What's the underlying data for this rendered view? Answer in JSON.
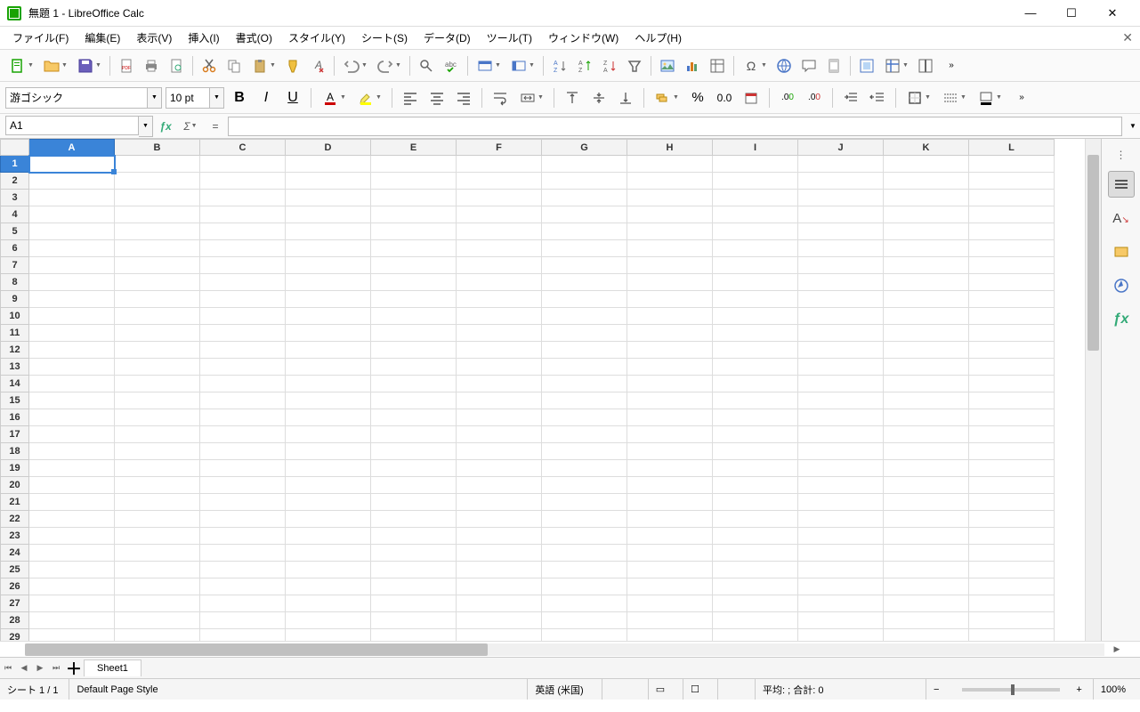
{
  "window": {
    "title": "無題 1 - LibreOffice Calc"
  },
  "menu": {
    "file": "ファイル(F)",
    "edit": "編集(E)",
    "view": "表示(V)",
    "insert": "挿入(I)",
    "format": "書式(O)",
    "style": "スタイル(Y)",
    "sheet": "シート(S)",
    "data": "データ(D)",
    "tools": "ツール(T)",
    "window": "ウィンドウ(W)",
    "help": "ヘルプ(H)"
  },
  "font": {
    "name": "游ゴシック",
    "size": "10 pt"
  },
  "cellref": {
    "value": "A1"
  },
  "columns": [
    "A",
    "B",
    "C",
    "D",
    "E",
    "F",
    "G",
    "H",
    "I",
    "J",
    "K",
    "L"
  ],
  "rows": [
    "1",
    "2",
    "3",
    "4",
    "5",
    "6",
    "7",
    "8",
    "9",
    "10",
    "11",
    "12",
    "13",
    "14",
    "15",
    "16",
    "17",
    "18",
    "19",
    "20",
    "21",
    "22",
    "23",
    "24",
    "25",
    "26",
    "27",
    "28",
    "29"
  ],
  "selected": {
    "col": 0,
    "row": 0
  },
  "tabs": {
    "sheet1": "Sheet1"
  },
  "status": {
    "sheet_count": "シート 1 / 1",
    "page_style": "Default Page Style",
    "language": "英語 (米国)",
    "summary": "平均: ; 合計: 0",
    "zoom": "100%"
  }
}
